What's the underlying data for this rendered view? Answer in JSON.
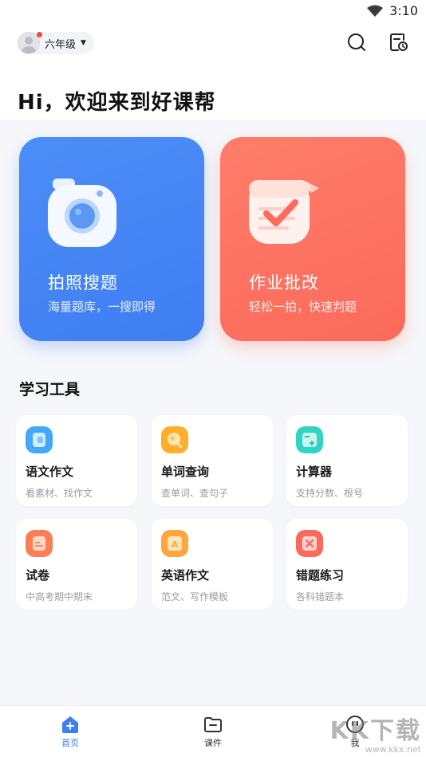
{
  "status_bar": {
    "time": "3:10"
  },
  "header": {
    "grade": "六年级",
    "greeting": "Hi，欢迎来到好课帮"
  },
  "main_cards": [
    {
      "title": "拍照搜题",
      "subtitle": "海量题库，一搜即得",
      "color": "#4287f5"
    },
    {
      "title": "作业批改",
      "subtitle": "轻松一拍，快速判题",
      "color": "#fd6e5e"
    }
  ],
  "tools": {
    "section_title": "学习工具",
    "items": [
      {
        "name": "语文作文",
        "desc": "看素材、找作文",
        "icon": "book-icon",
        "color": "#43a8f8"
      },
      {
        "name": "单词查询",
        "desc": "查单词、查句子",
        "icon": "search-word-icon",
        "color": "#ffae2c"
      },
      {
        "name": "计算器",
        "desc": "支持分数、根号",
        "icon": "calculator-icon",
        "color": "#2fd4c4"
      },
      {
        "name": "试卷",
        "desc": "中高考期中期末",
        "icon": "paper-icon",
        "color": "#fb7e55"
      },
      {
        "name": "英语作文",
        "desc": "范文、写作模板",
        "icon": "english-essay-icon",
        "color": "#ffa63a"
      },
      {
        "name": "错题练习",
        "desc": "各科错题本",
        "icon": "mistake-icon",
        "color": "#fa6a5c"
      }
    ]
  },
  "bottom_nav": [
    {
      "label": "首页",
      "icon": "home-icon",
      "active": true
    },
    {
      "label": "课件",
      "icon": "courseware-icon",
      "active": false
    },
    {
      "label": "我",
      "icon": "profile-icon",
      "active": false
    }
  ],
  "watermark": {
    "big": "KK下载",
    "small": "www.kkx.net"
  }
}
